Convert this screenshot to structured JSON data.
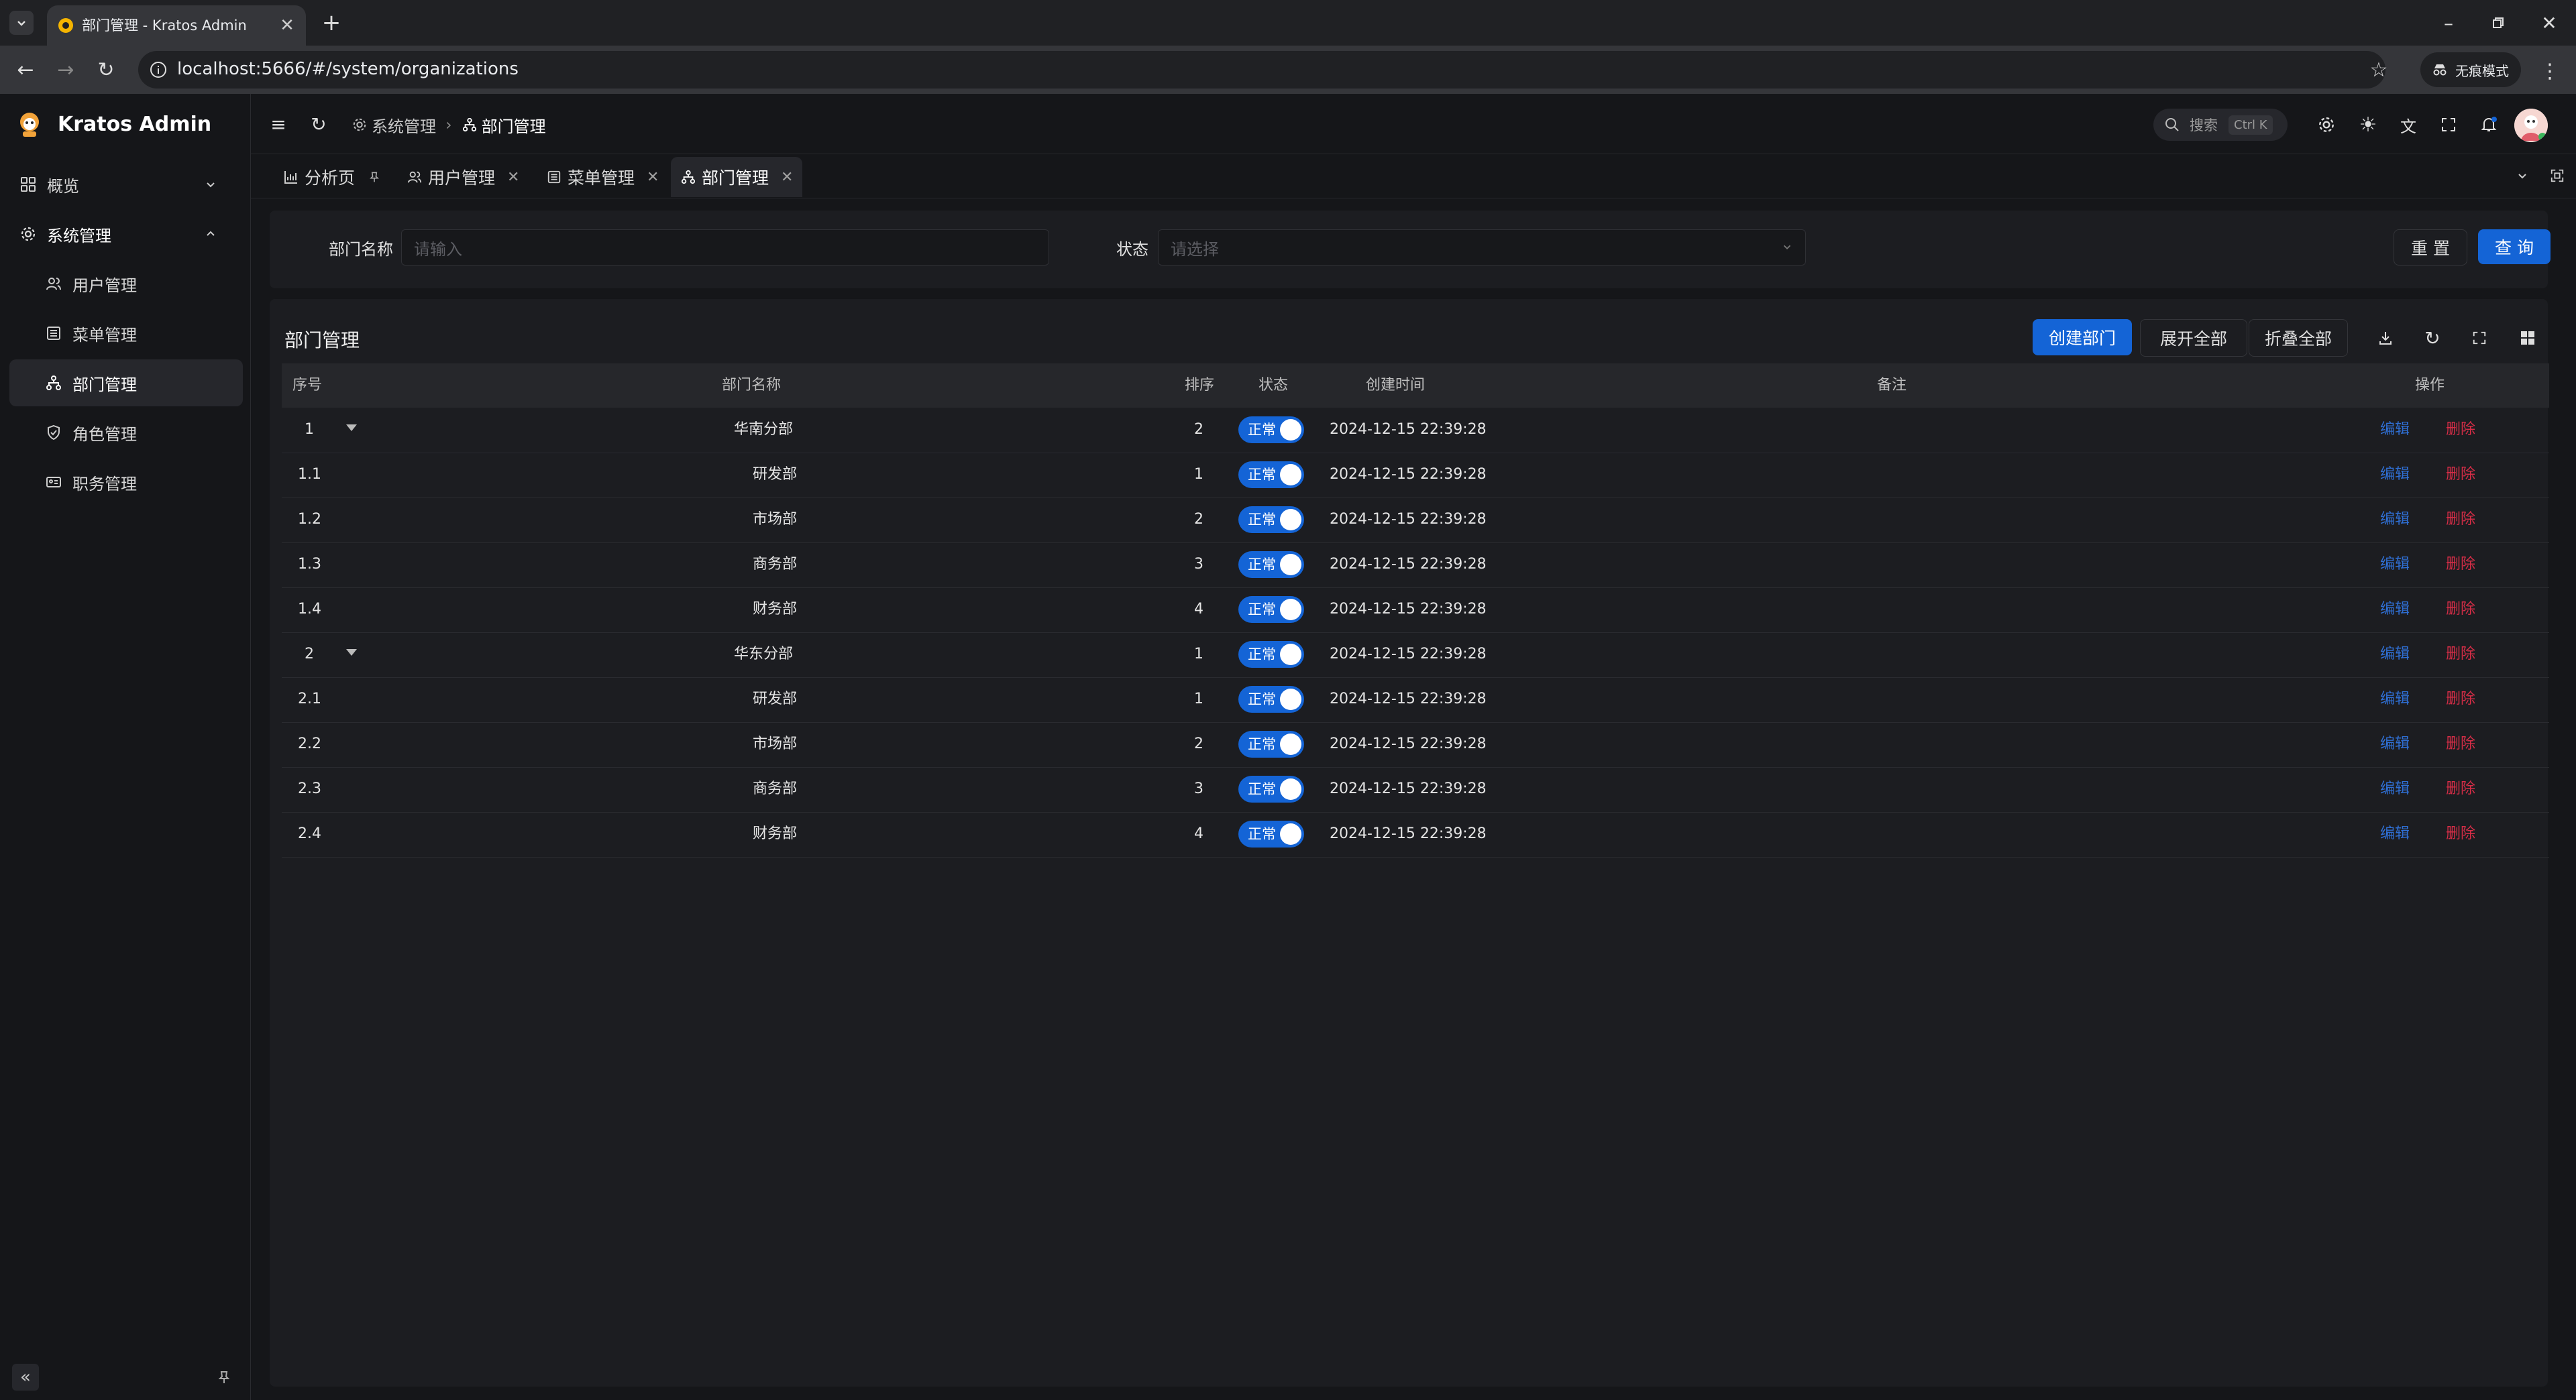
{
  "browser": {
    "tab_title": "部门管理 - Kratos Admin",
    "url": "localhost:5666/#/system/organizations",
    "incognito_label": "无痕模式"
  },
  "app": {
    "name": "Kratos Admin"
  },
  "sidebar": {
    "items": [
      {
        "label": "概览",
        "icon": "dashboard-icon",
        "level": 0,
        "expanded": false
      },
      {
        "label": "系统管理",
        "icon": "gear-icon",
        "level": 0,
        "expanded": true
      },
      {
        "label": "用户管理",
        "icon": "user-icon",
        "level": 1
      },
      {
        "label": "菜单管理",
        "icon": "menu-list-icon",
        "level": 1
      },
      {
        "label": "部门管理",
        "icon": "org-tree-icon",
        "level": 1,
        "active": true
      },
      {
        "label": "角色管理",
        "icon": "shield-icon",
        "level": 1
      },
      {
        "label": "职务管理",
        "icon": "id-card-icon",
        "level": 1
      }
    ]
  },
  "header": {
    "breadcrumb": [
      "系统管理",
      "部门管理"
    ],
    "search_label": "搜索",
    "search_shortcut": "Ctrl K"
  },
  "tabs": [
    {
      "label": "分析页",
      "icon": "chart-icon",
      "pinned": true
    },
    {
      "label": "用户管理",
      "icon": "user-icon"
    },
    {
      "label": "菜单管理",
      "icon": "menu-list-icon"
    },
    {
      "label": "部门管理",
      "icon": "org-tree-icon",
      "active": true
    }
  ],
  "search_form": {
    "name_label": "部门名称",
    "name_placeholder": "请输入",
    "status_label": "状态",
    "status_placeholder": "请选择",
    "reset_label": "重 置",
    "query_label": "查 询"
  },
  "table": {
    "title": "部门管理",
    "create_label": "创建部门",
    "expand_all_label": "展开全部",
    "collapse_all_label": "折叠全部",
    "columns": [
      "序号",
      "部门名称",
      "排序",
      "状态",
      "创建时间",
      "备注",
      "操作"
    ],
    "status_text": "正常",
    "edit_label": "编辑",
    "delete_label": "删除",
    "rows": [
      {
        "index": "1",
        "name": "华南分部",
        "sort": "2",
        "created": "2024-12-15 22:39:28",
        "remark": "",
        "parent": true
      },
      {
        "index": "1.1",
        "name": "研发部",
        "sort": "1",
        "created": "2024-12-15 22:39:28",
        "remark": ""
      },
      {
        "index": "1.2",
        "name": "市场部",
        "sort": "2",
        "created": "2024-12-15 22:39:28",
        "remark": ""
      },
      {
        "index": "1.3",
        "name": "商务部",
        "sort": "3",
        "created": "2024-12-15 22:39:28",
        "remark": ""
      },
      {
        "index": "1.4",
        "name": "财务部",
        "sort": "4",
        "created": "2024-12-15 22:39:28",
        "remark": ""
      },
      {
        "index": "2",
        "name": "华东分部",
        "sort": "1",
        "created": "2024-12-15 22:39:28",
        "remark": "",
        "parent": true
      },
      {
        "index": "2.1",
        "name": "研发部",
        "sort": "1",
        "created": "2024-12-15 22:39:28",
        "remark": ""
      },
      {
        "index": "2.2",
        "name": "市场部",
        "sort": "2",
        "created": "2024-12-15 22:39:28",
        "remark": ""
      },
      {
        "index": "2.3",
        "name": "商务部",
        "sort": "3",
        "created": "2024-12-15 22:39:28",
        "remark": ""
      },
      {
        "index": "2.4",
        "name": "财务部",
        "sort": "4",
        "created": "2024-12-15 22:39:28",
        "remark": ""
      }
    ]
  },
  "colors": {
    "primary": "#1464d6",
    "danger": "#d62d47",
    "background": "#151619",
    "card": "#1c1d21"
  }
}
